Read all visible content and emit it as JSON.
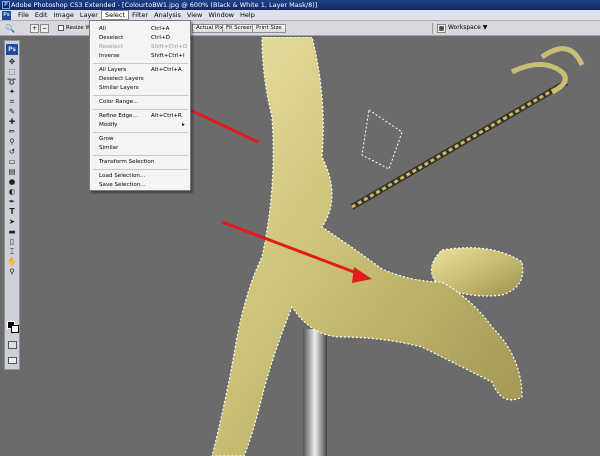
{
  "window": {
    "title": "Adobe Photoshop CS3 Extended - [ColourtoBW1.jpg @ 600% (Black & White 1, Layer Mask/8)]"
  },
  "menubar": {
    "logo": "Ps",
    "items": [
      {
        "label": "File"
      },
      {
        "label": "Edit"
      },
      {
        "label": "Image"
      },
      {
        "label": "Layer"
      },
      {
        "label": "Select",
        "active": true
      },
      {
        "label": "Filter"
      },
      {
        "label": "Analysis"
      },
      {
        "label": "View"
      },
      {
        "label": "Window"
      },
      {
        "label": "Help"
      }
    ]
  },
  "options": {
    "resize_windows_label": "Resize Win",
    "buttons": [
      "Actual Pixels",
      "Fit Screen",
      "Print Size"
    ],
    "workspace_label": "Workspace ▼"
  },
  "toolbox": {
    "logo": "Ps"
  },
  "select_menu": {
    "items": [
      {
        "label": "All",
        "shortcut": "Ctrl+A"
      },
      {
        "label": "Deselect",
        "shortcut": "Ctrl+D"
      },
      {
        "label": "Reselect",
        "shortcut": "Shift+Ctrl+D",
        "disabled": true
      },
      {
        "label": "Inverse",
        "shortcut": "Shift+Ctrl+I"
      },
      {
        "sep": true
      },
      {
        "label": "All Layers",
        "shortcut": "Alt+Ctrl+A"
      },
      {
        "label": "Deselect Layers",
        "shortcut": ""
      },
      {
        "label": "Similar Layers",
        "shortcut": ""
      },
      {
        "sep": true
      },
      {
        "label": "Color Range...",
        "shortcut": ""
      },
      {
        "sep": true
      },
      {
        "label": "Refine Edge...",
        "shortcut": "Alt+Ctrl+R"
      },
      {
        "label": "Modify",
        "shortcut": "",
        "submenu": true
      },
      {
        "sep": true
      },
      {
        "label": "Grow",
        "shortcut": ""
      },
      {
        "label": "Similar",
        "shortcut": ""
      },
      {
        "sep": true
      },
      {
        "label": "Transform Selection",
        "shortcut": ""
      },
      {
        "sep": true
      },
      {
        "label": "Load Selection...",
        "shortcut": ""
      },
      {
        "label": "Save Selection...",
        "shortcut": ""
      }
    ]
  },
  "colors": {
    "accent": "#e21b1b",
    "statue": "#c9c07a",
    "canvas": "#6b6b6b"
  }
}
